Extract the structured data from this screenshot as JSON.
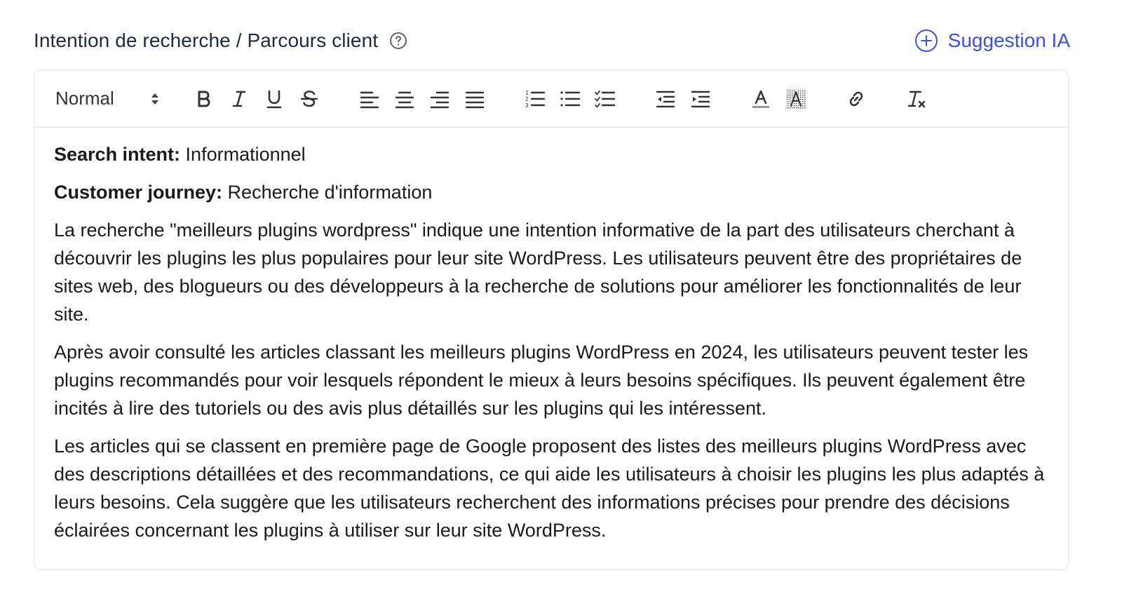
{
  "header": {
    "title": "Intention de recherche / Parcours client",
    "ai_button_label": "Suggestion IA"
  },
  "toolbar": {
    "format_select": "Normal"
  },
  "content": {
    "search_intent_label": "Search intent:",
    "search_intent_value": " Informationnel",
    "customer_journey_label": "Customer journey:",
    "customer_journey_value": " Recherche d'information",
    "paragraphs": [
      "La recherche \"meilleurs plugins wordpress\" indique une intention informative de la part des utilisateurs cherchant à découvrir les plugins les plus populaires pour leur site WordPress. Les utilisateurs peuvent être des propriétaires de sites web, des blogueurs ou des développeurs à la recherche de solutions pour améliorer les fonctionnalités de leur site.",
      "Après avoir consulté les articles classant les meilleurs plugins WordPress en 2024, les utilisateurs peuvent tester les plugins recommandés pour voir lesquels répondent le mieux à leurs besoins spécifiques. Ils peuvent également être incités à lire des tutoriels ou des avis plus détaillés sur les plugins qui les intéressent.",
      "Les articles qui se classent en première page de Google proposent des listes des meilleurs plugins WordPress avec des descriptions détaillées et des recommandations, ce qui aide les utilisateurs à choisir les plugins les plus adaptés à leurs besoins. Cela suggère que les utilisateurs recherchent des informations précises pour prendre des décisions éclairées concernant les plugins à utiliser sur leur site WordPress."
    ]
  },
  "colors": {
    "accent": "#3b4fe0",
    "title": "#1e2a44",
    "border": "#e3e6eb"
  }
}
